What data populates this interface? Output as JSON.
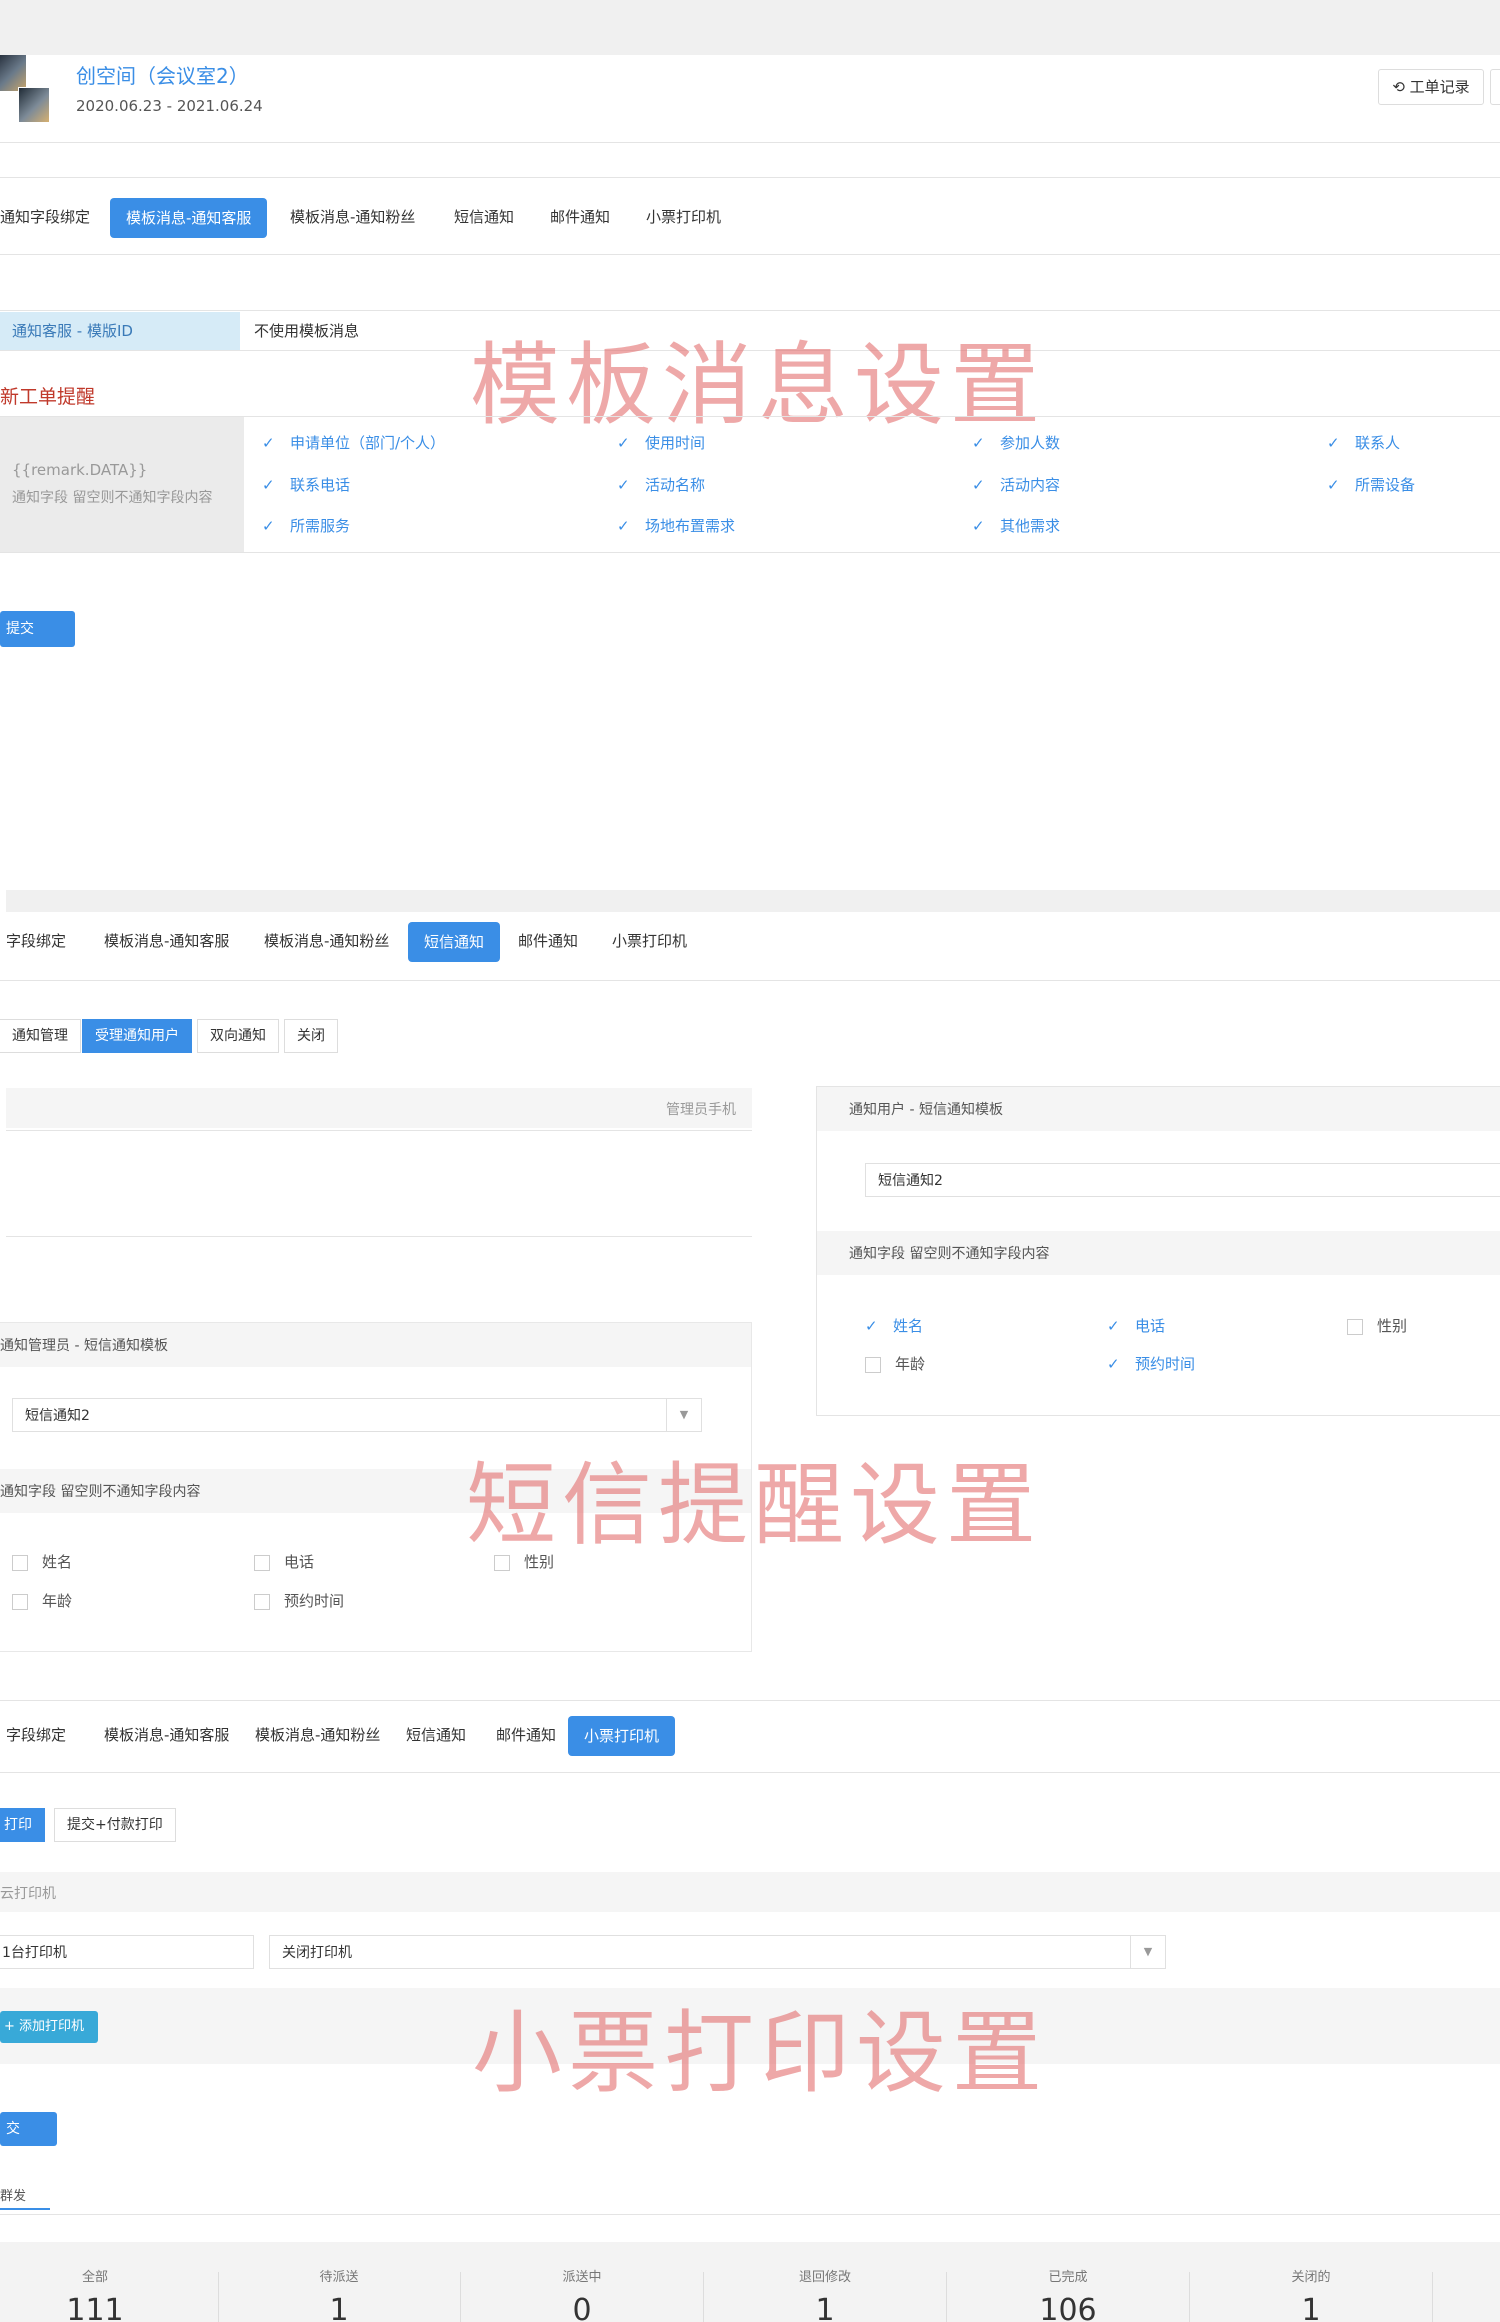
{
  "header": {
    "title": "创空间（会议室2）",
    "date_range": "2020.06.23 - 2021.06.24",
    "work_record_label": "工单记录",
    "history_icon": "history-icon"
  },
  "section1": {
    "tabs": [
      "通知字段绑定",
      "模板消息-通知客服",
      "模板消息-通知粉丝",
      "短信通知",
      "邮件通知",
      "小票打印机"
    ],
    "active_tab": 1,
    "template_label": "通知客服 - 模版ID",
    "template_value": "不使用模板消息",
    "watermark": "模板消息设置",
    "new_order_title": "新工单提醒",
    "field_hint_line1": "{{remark.DATA}}",
    "field_hint_line2": "通知字段 留空则不通知字段内容",
    "checkboxes": [
      {
        "label": "申请单位（部门/个人）",
        "checked": true
      },
      {
        "label": "使用时间",
        "checked": true
      },
      {
        "label": "参加人数",
        "checked": true
      },
      {
        "label": "联系人",
        "checked": true
      },
      {
        "label": "联系电话",
        "checked": true
      },
      {
        "label": "活动名称",
        "checked": true
      },
      {
        "label": "活动内容",
        "checked": true
      },
      {
        "label": "所需设备",
        "checked": true
      },
      {
        "label": "所需服务",
        "checked": true
      },
      {
        "label": "场地布置需求",
        "checked": true
      },
      {
        "label": "其他需求",
        "checked": true
      }
    ],
    "submit_label": "提交"
  },
  "section2": {
    "tabs": [
      "字段绑定",
      "模板消息-通知客服",
      "模板消息-通知粉丝",
      "短信通知",
      "邮件通知",
      "小票打印机"
    ],
    "active_tab": 3,
    "subtabs": [
      "通知管理",
      "受理通知用户",
      "双向通知",
      "关闭"
    ],
    "active_subtab": 1,
    "admin_phone_label": "管理员手机",
    "admin_template_label": "通知管理员 - 短信通知模板",
    "admin_template_value": "短信通知2",
    "admin_fields_label": "通知字段 留空则不通知字段内容",
    "admin_checkboxes": [
      {
        "label": "姓名",
        "checked": false
      },
      {
        "label": "电话",
        "checked": false
      },
      {
        "label": "性别",
        "checked": false
      },
      {
        "label": "年龄",
        "checked": false
      },
      {
        "label": "预约时间",
        "checked": false
      }
    ],
    "user_template_label": "通知用户 - 短信通知模板",
    "user_template_value": "短信通知2",
    "user_fields_label": "通知字段 留空则不通知字段内容",
    "user_checkboxes": [
      {
        "label": "姓名",
        "checked": true
      },
      {
        "label": "电话",
        "checked": true
      },
      {
        "label": "性别",
        "checked": false
      },
      {
        "label": "年龄",
        "checked": false
      },
      {
        "label": "预约时间",
        "checked": true
      }
    ],
    "watermark": "短信提醒设置"
  },
  "section3": {
    "tabs": [
      "字段绑定",
      "模板消息-通知客服",
      "模板消息-通知粉丝",
      "短信通知",
      "邮件通知",
      "小票打印机"
    ],
    "active_tab": 5,
    "subtabs": [
      "打印",
      "提交+付款打印"
    ],
    "active_subtab": 0,
    "cloud_printer_label": "云打印机",
    "printer_name": "1台打印机",
    "printer_select_value": "关闭打印机",
    "add_printer_label": "+ 添加打印机",
    "submit_label": "交",
    "watermark": "小票打印设置",
    "bottom_tab": "群发"
  },
  "stats": [
    {
      "label": "全部",
      "value": "111"
    },
    {
      "label": "待派送",
      "value": "1"
    },
    {
      "label": "派送中",
      "value": "0"
    },
    {
      "label": "退回修改",
      "value": "1"
    },
    {
      "label": "已完成",
      "value": "106"
    },
    {
      "label": "关闭的",
      "value": "1"
    }
  ]
}
